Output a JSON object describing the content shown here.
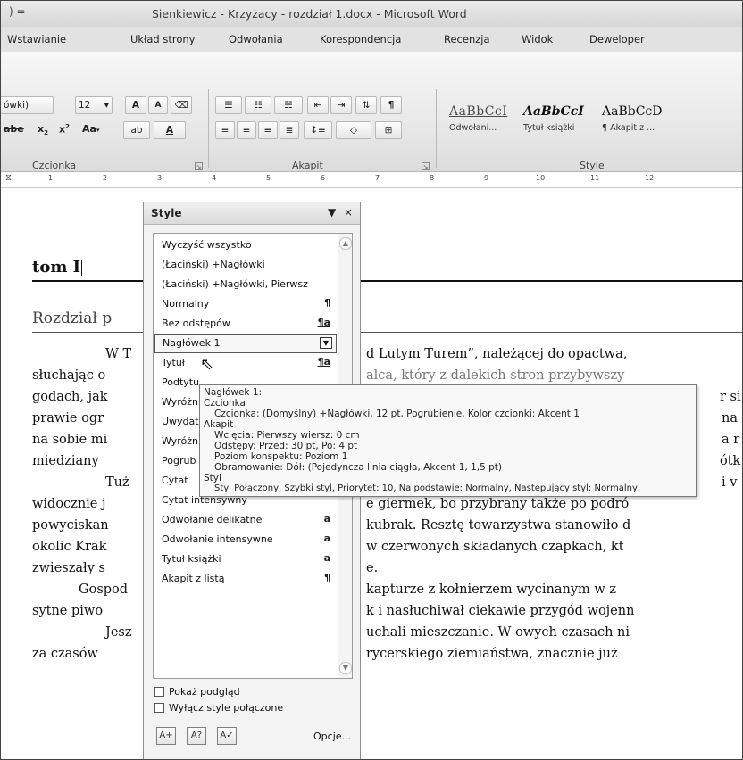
{
  "window": {
    "title": "Sienkiewicz - Krzyżacy - rozdział 1.docx - Microsoft Word",
    "qa_glyph": ") ="
  },
  "tabs": [
    "Wstawianie",
    "Układ strony",
    "Odwołania",
    "Korespondencja",
    "Recenzja",
    "Widok",
    "Deweloper"
  ],
  "ribbon": {
    "font": {
      "name_value": "ówki)",
      "size_value": "12",
      "label": "Czcionka",
      "grow_label": "A",
      "shrink_label": "A",
      "strike_label": "abe",
      "sub_label": "x",
      "sup_label": "x",
      "case_label": "Aa",
      "highlight_label": "ab",
      "color_label": "A"
    },
    "paragraph": {
      "label": "Akapit",
      "pilcrow": "¶"
    },
    "styles": {
      "label": "Style",
      "items": [
        {
          "preview": "AaBbCcI",
          "name": "Odwołani..."
        },
        {
          "preview": "AaBbCcI",
          "name": "Tytuł książki"
        },
        {
          "preview": "AaBbCcD",
          "name": "¶ Akapit z ..."
        }
      ]
    }
  },
  "ruler": {
    "numbers": [
      "1",
      "2",
      "3",
      "4",
      "5",
      "6",
      "7",
      "8",
      "9",
      "10",
      "11",
      "12"
    ]
  },
  "document": {
    "heading1": "tom I",
    "heading2": "Rozdział p",
    "lines": [
      "W T",
      "słuchając o",
      "godach, jak",
      "prawie ogr",
      "na sobie mi",
      "miedziany",
      "Tuż",
      "widocznie j",
      "powyciskan",
      "okolic Krak",
      "zwieszały s",
      "Gospod",
      "sytne piwo",
      "Jesz",
      "za czasów"
    ],
    "lines_right": [
      "d Lutym Turem”, należącej do opactwa,",
      "",
      "",
      "",
      "",
      "",
      "",
      "e giermek, bo przybrany także po podró",
      "kubrak. Resztę towarzystwa stanowiło d",
      "w czerwonych składanych czapkach, kt",
      "e.",
      "kapturze z kołnierzem wycinanym w z",
      "k i nasłuchiwał ciekawie przygód wojenn",
      "uchali mieszczanie. W owych czasach ni",
      "rycerskiego ziemiaństwa, znacznie już"
    ],
    "fragments": {
      "l2_tail": "alca, który z dalekich stron przybywszy",
      "l3_tail": "r si",
      "l4_tail": "na",
      "l5_tail": "a r",
      "l6_tail": "ótk",
      "l7_tail": "i v"
    }
  },
  "styles_pane": {
    "title": "Style",
    "menu_glyph": "▼",
    "close_glyph": "×",
    "items": [
      {
        "name": "Wyczyść wszystko",
        "glyph": ""
      },
      {
        "name": "(Łaciński) +Nagłówki",
        "glyph": ""
      },
      {
        "name": "(Łaciński) +Nagłówki, Pierwsz",
        "glyph": ""
      },
      {
        "name": "Normalny",
        "glyph": "¶"
      },
      {
        "name": "Bez odstępów",
        "glyph": "¶a"
      },
      {
        "name": "Nagłówek 1",
        "glyph": "▼"
      },
      {
        "name": "Tytuł",
        "glyph": "¶a"
      },
      {
        "name": "Podtytu",
        "glyph": ""
      },
      {
        "name": "Wyróżn",
        "glyph": ""
      },
      {
        "name": "Uwydat",
        "glyph": ""
      },
      {
        "name": "Wyróżn",
        "glyph": ""
      },
      {
        "name": "Pogrub",
        "glyph": ""
      },
      {
        "name": "Cytat",
        "glyph": ""
      },
      {
        "name": "Cytat intensywny",
        "glyph": ""
      },
      {
        "name": "Odwołanie delikatne",
        "glyph": "a"
      },
      {
        "name": "Odwołanie intensywne",
        "glyph": "a"
      },
      {
        "name": "Tytuł książki",
        "glyph": "a"
      },
      {
        "name": "Akapit z listą",
        "glyph": "¶"
      }
    ],
    "show_preview": "Pokaż podgląd",
    "disable_linked": "Wyłącz style połączone",
    "options": "Opcje..."
  },
  "tooltip": {
    "lines": [
      "Nagłówek 1:",
      "Czcionka",
      "Czcionka:  (Domyślny) +Nagłówki, 12 pt, Pogrubienie, Kolor czcionki: Akcent 1",
      "Akapit",
      "Wcięcia:  Pierwszy wiersz:  0 cm",
      "Odstępy:  Przed:  30 pt, Po:  4 pt",
      "Poziom konspektu:  Poziom 1",
      "Obramowanie:  Dół: (Pojedyncza linia ciągła, Akcent 1,  1,5 pt)",
      "Styl",
      "Styl Połączony, Szybki styl, Priorytet: 10, Na podstawie: Normalny, Następujący styl: Normalny"
    ]
  }
}
